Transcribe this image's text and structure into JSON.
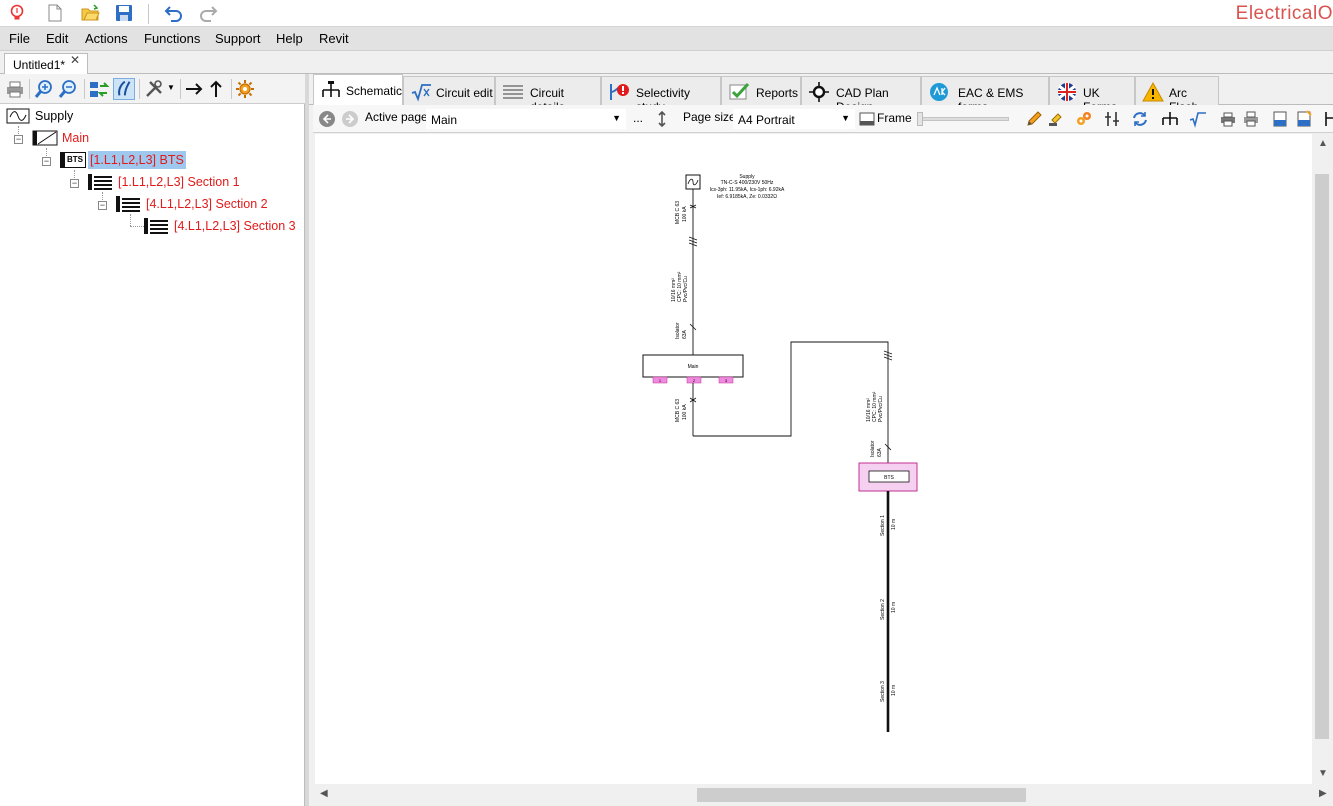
{
  "app": {
    "brand": "ElectricalO"
  },
  "menu": [
    "File",
    "Edit",
    "Actions",
    "Functions",
    "Support",
    "Help",
    "Revit"
  ],
  "document_tab": {
    "title": "Untitled1*",
    "close": "✕"
  },
  "tree": {
    "supply": "Supply",
    "main": "Main",
    "bts": "[1.L1,L2,L3] BTS",
    "section1": "[1.L1,L2,L3] Section 1",
    "section2": "[4.L1,L2,L3] Section 2",
    "section3": "[4.L1,L2,L3] Section 3",
    "bts_icon_text": "BTS"
  },
  "tabs": [
    "Schematic",
    "Circuit edit",
    "Circuit details",
    "Selectivity study",
    "Reports",
    "CAD Plan Design",
    "EAC & EMS forms",
    "UK Forms",
    "Arc Flash"
  ],
  "pagebar": {
    "active_page_label": "Active page",
    "active_page": "Main",
    "ellipsis": "...",
    "page_size_label": "Page size",
    "page_size": "A4 Portrait",
    "frame_label": "Frame"
  },
  "schematic": {
    "supply_title": "Supply",
    "supply_line1": "TN-C-S 400/230V 50Hz",
    "supply_line2": "Ics-3ph: 11.95kA, Ics-1ph: 6.92kA",
    "supply_line3": "Ief: 6.9185kA, Ze: 0.0332Ω",
    "mcb1": "MCB C 63",
    "mcb1b": "100 kA",
    "cable1a": "10/16 mm²",
    "cable1b": "CPC: 10 mm²",
    "cable1c": "Pvc/Pvc/Cu",
    "isolator1": "Isolator",
    "isolator1b": "63A",
    "main_label": "Main",
    "mcb2": "MCB C 63",
    "mcb2b": "100 kA",
    "cable2a": "10/16 mm²",
    "cable2b": "CPC: 10 mm²",
    "cable2c": "Pvc/Pvc/Cu",
    "isolator2": "Isolator",
    "isolator2b": "63A",
    "bts_label": "BTS",
    "sec1": "Section 1",
    "sec1b": "10 m",
    "sec2": "Section 2",
    "sec2b": "10 m",
    "sec3": "Section 3",
    "sec3b": "10 m",
    "main_pill1": "1",
    "main_pill2": "2",
    "main_pill3": "3"
  },
  "colors": {
    "red": "#e11b1b",
    "selected": "#9fc8ef",
    "bts_fill": "#f6d0f0",
    "pill": "#f08ae0"
  }
}
